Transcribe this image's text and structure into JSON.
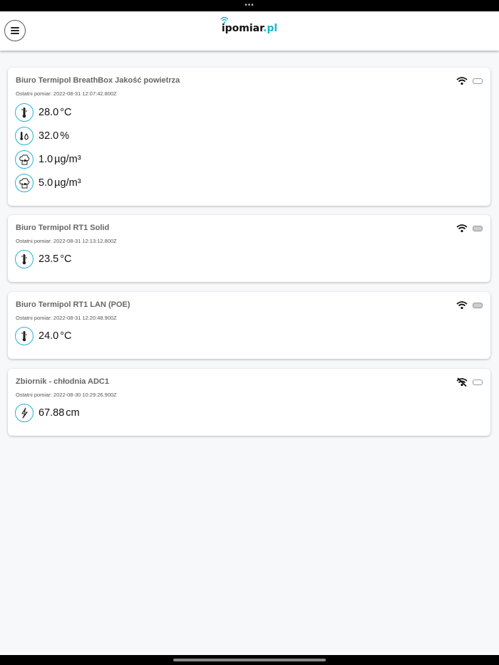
{
  "app": {
    "logo_main": "ipomiar",
    "logo_suffix": ".pl"
  },
  "status": {
    "dots": "•••"
  },
  "devices": [
    {
      "name": "Biuro Termipol BreathBox Jakość powietrza",
      "last_measurement": "Ostatni pomiar: 2022-08-31 12:07:42.800Z",
      "signal": "wifi-icon",
      "battery": "empty",
      "readings": [
        {
          "value": "28.0",
          "unit": "°C",
          "icon": "thermometer-icon"
        },
        {
          "value": "32.0",
          "unit": "%",
          "icon": "humidity-icon"
        },
        {
          "value": "1.0",
          "unit": "µg/m³",
          "icon": "smog-icon"
        },
        {
          "value": "5.0",
          "unit": "µg/m³",
          "icon": "smog-icon"
        }
      ]
    },
    {
      "name": "Biuro Termipol RT1 Solid",
      "last_measurement": "Ostatni pomiar: 2022-08-31 12:13:12.800Z",
      "signal": "wifi-icon",
      "battery": "full",
      "readings": [
        {
          "value": "23.5",
          "unit": "°C",
          "icon": "thermometer-icon"
        }
      ]
    },
    {
      "name": "Biuro Termipol RT1 LAN (POE)",
      "last_measurement": "Ostatni pomiar: 2022-08-31 12:20:48.900Z",
      "signal": "wifi-icon",
      "battery": "full",
      "readings": [
        {
          "value": "24.0",
          "unit": "°C",
          "icon": "thermometer-icon"
        }
      ]
    },
    {
      "name": "Zbiornik - chłodnia ADC1",
      "last_measurement": "Ostatni pomiar: 2022-08-30 10:29:26.900Z",
      "signal": "wifi-off-icon",
      "battery": "empty",
      "readings": [
        {
          "value": "67.88",
          "unit": "cm",
          "icon": "voltage-icon"
        }
      ]
    }
  ],
  "colors": {
    "accent": "#27b3d3",
    "background": "#f7f8fa"
  }
}
